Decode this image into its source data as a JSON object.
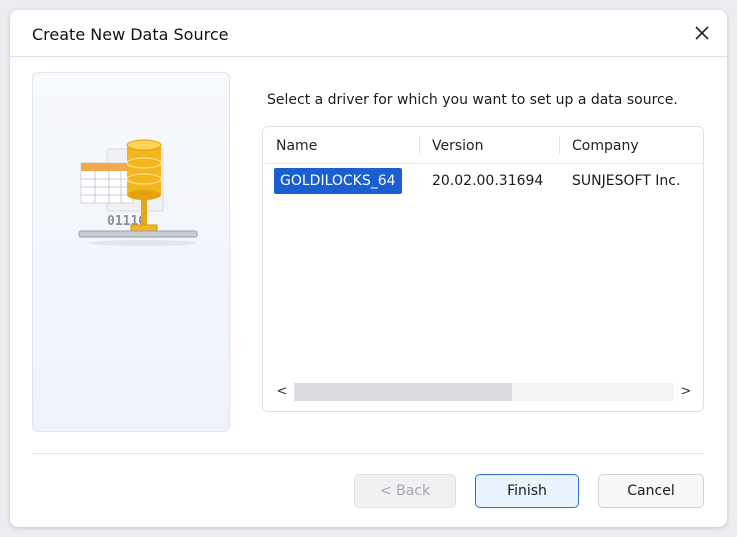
{
  "dialog": {
    "title": "Create New Data Source",
    "prompt": "Select a driver for which you want to set up a data source.",
    "illustration_text": "01110"
  },
  "driver_list": {
    "columns": [
      "Name",
      "Version",
      "Company"
    ],
    "rows": [
      {
        "name": "GOLDILOCKS_64",
        "version": "20.02.00.31694",
        "company": "SUNJESOFT Inc.",
        "selected": true
      }
    ],
    "scroll_left": "<",
    "scroll_right": ">"
  },
  "buttons": {
    "back": "< Back",
    "finish": "Finish",
    "cancel": "Cancel"
  },
  "colors": {
    "selection": "#1a5fcf",
    "default_button_border": "#2e6fd6",
    "database": "#f2b51c"
  },
  "icons": [
    "close-icon",
    "database-network-icon",
    "chevron-left-icon",
    "chevron-right-icon"
  ]
}
